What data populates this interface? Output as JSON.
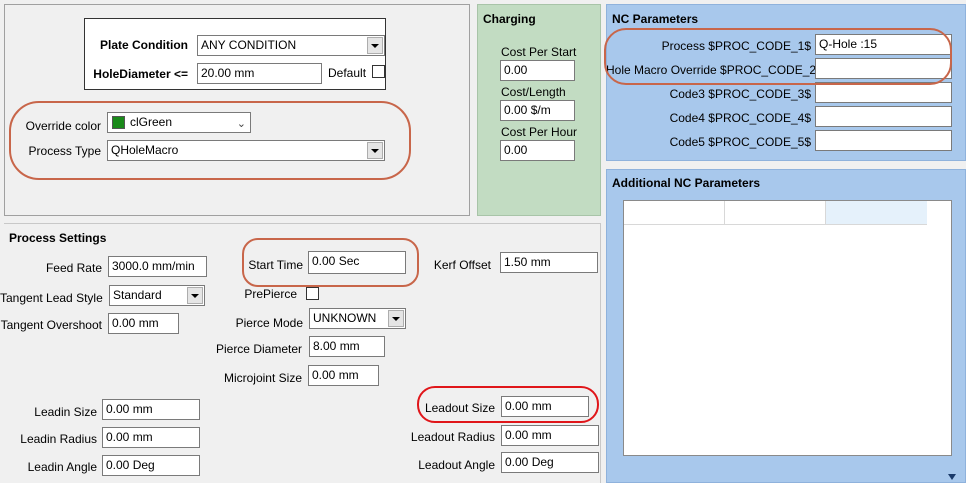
{
  "plate": {
    "condition_label": "Plate Condition",
    "condition_value": "ANY CONDITION",
    "hole_diameter_label": "HoleDiameter <=",
    "hole_diameter_value": "20.00 mm",
    "default_label": "Default"
  },
  "override": {
    "color_label": "Override color",
    "color_value": "clGreen",
    "color_swatch": "#1a8a1a",
    "process_type_label": "Process Type",
    "process_type_value": "QHoleMacro"
  },
  "charging": {
    "title": "Charging",
    "cost_per_start_label": "Cost Per Start",
    "cost_per_start_value": "0.00",
    "cost_length_label": "Cost/Length",
    "cost_length_value": "0.00 $/m",
    "cost_per_hour_label": "Cost Per Hour",
    "cost_per_hour_value": "0.00"
  },
  "nc": {
    "title": "NC Parameters",
    "rows": [
      {
        "label": "Process  $PROC_CODE_1$",
        "value": "Q-Hole :15"
      },
      {
        "label": "Hole Macro Override $PROC_CODE_2$",
        "value": ""
      },
      {
        "label": "Code3 $PROC_CODE_3$",
        "value": ""
      },
      {
        "label": "Code4 $PROC_CODE_4$",
        "value": ""
      },
      {
        "label": "Code5 $PROC_CODE_5$",
        "value": ""
      }
    ]
  },
  "additional_nc": {
    "title": "Additional NC Parameters"
  },
  "process": {
    "title": "Process Settings",
    "feed_rate_label": "Feed Rate",
    "feed_rate_value": "3000.0 mm/min",
    "tangent_lead_style_label": "Tangent Lead Style",
    "tangent_lead_style_value": "Standard",
    "tangent_overshoot_label": "Tangent Overshoot",
    "tangent_overshoot_value": "0.00 mm",
    "start_time_label": "Start Time",
    "start_time_value": "0.00 Sec",
    "kerf_offset_label": "Kerf Offset",
    "kerf_offset_value": "1.50 mm",
    "prepierce_label": "PrePierce",
    "pierce_mode_label": "Pierce Mode",
    "pierce_mode_value": "UNKNOWN",
    "pierce_diameter_label": "Pierce Diameter",
    "pierce_diameter_value": "8.00 mm",
    "microjoint_size_label": "Microjoint Size",
    "microjoint_size_value": "0.00 mm",
    "leadin_size_label": "Leadin Size",
    "leadin_size_value": "0.00 mm",
    "leadin_radius_label": "Leadin Radius",
    "leadin_radius_value": "0.00 mm",
    "leadin_angle_label": "Leadin Angle",
    "leadin_angle_value": "0.00 Deg",
    "leadout_size_label": "Leadout Size",
    "leadout_size_value": "0.00 mm",
    "leadout_radius_label": "Leadout Radius",
    "leadout_radius_value": "0.00 mm",
    "leadout_angle_label": "Leadout Angle",
    "leadout_angle_value": "0.00 Deg"
  }
}
